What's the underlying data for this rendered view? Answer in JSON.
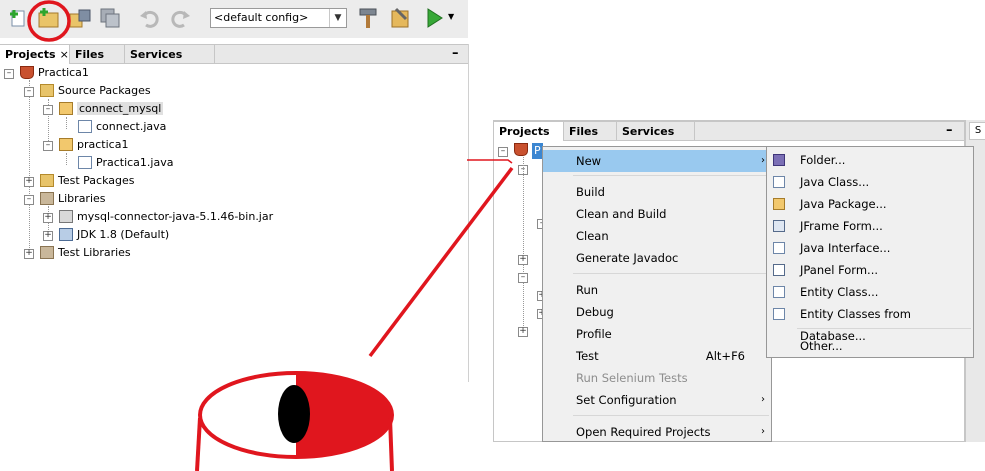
{
  "toolbar": {
    "config_combo": "<default config>",
    "buttons": [
      "new-file-icon",
      "new-project-icon",
      "open-project-icon",
      "save-all-icon",
      "undo-icon",
      "redo-icon",
      "build-hammer-icon",
      "clean-build-icon",
      "run-icon"
    ]
  },
  "left_panel": {
    "tabs": [
      {
        "label": "Projects",
        "close": "×"
      },
      {
        "label": "Files"
      },
      {
        "label": "Services"
      }
    ],
    "minimize": "–",
    "tree": [
      {
        "label": "Practica1"
      },
      {
        "label": "Source Packages"
      },
      {
        "label": "connect_mysql"
      },
      {
        "label": "connect.java"
      },
      {
        "label": "practica1"
      },
      {
        "label": "Practica1.java"
      },
      {
        "label": "Test Packages"
      },
      {
        "label": "Libraries"
      },
      {
        "label": "mysql-connector-java-5.1.46-bin.jar"
      },
      {
        "label": "JDK 1.8 (Default)"
      },
      {
        "label": "Test Libraries"
      }
    ]
  },
  "right_panel": {
    "tabs": [
      {
        "label": "Projects",
        "close": "×"
      },
      {
        "label": "Files"
      },
      {
        "label": "Services"
      }
    ],
    "minimize": "–",
    "side_tab": "S",
    "root_label": "P"
  },
  "context_menu": {
    "items": [
      {
        "label": "New",
        "submenu": "›",
        "highlighted": true
      },
      {
        "label": "Build"
      },
      {
        "label": "Clean and Build"
      },
      {
        "label": "Clean"
      },
      {
        "label": "Generate Javadoc"
      },
      {
        "label": "Run"
      },
      {
        "label": "Debug"
      },
      {
        "label": "Profile"
      },
      {
        "label": "Test",
        "shortcut": "Alt+F6"
      },
      {
        "label": "Run Selenium Tests",
        "disabled": true
      },
      {
        "label": "Set Configuration",
        "submenu": "›"
      },
      {
        "label": "Open Required Projects",
        "submenu": "›"
      }
    ]
  },
  "new_submenu": {
    "items": [
      {
        "label": "Folder..."
      },
      {
        "label": "Java Class..."
      },
      {
        "label": "Java Package..."
      },
      {
        "label": "JFrame Form..."
      },
      {
        "label": "Java Interface..."
      },
      {
        "label": "JPanel Form..."
      },
      {
        "label": "Entity Class..."
      },
      {
        "label": "Entity Classes from Database..."
      },
      {
        "label": "Other..."
      }
    ]
  },
  "colors": {
    "annotation_red": "#e0161e",
    "menu_highlight": "#99c9ef",
    "menu_bg": "#f0f0f0"
  }
}
